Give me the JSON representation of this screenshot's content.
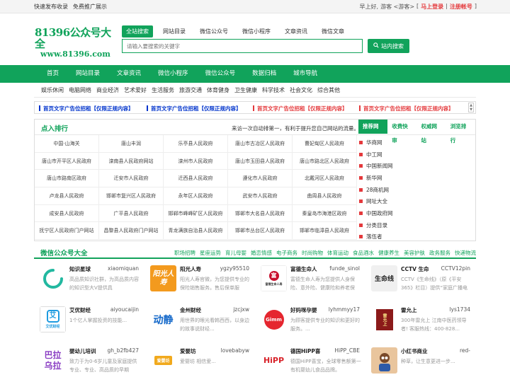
{
  "topbar": {
    "links": [
      "快速发布收录",
      "免费推广展示"
    ],
    "greeting": "早上好,",
    "guest": "游客 <游客>",
    "bracket_open": "[",
    "login": "马上登录",
    "sep": "|",
    "register": "注册帐号",
    "bracket_close": "]"
  },
  "logo": {
    "line1": "81396公众号大全",
    "line2": "www.81396.com"
  },
  "search": {
    "tabs": [
      "全站搜索",
      "网站目录",
      "微信公众号",
      "微信小程序",
      "文章资讯",
      "微信文章"
    ],
    "placeholder": "请输入要搜索的关键字",
    "button": "站内搜索",
    "button_icon": "search-icon"
  },
  "mainnav": [
    "首页",
    "网站目录",
    "文章资讯",
    "微信小程序",
    "微信公众号",
    "数据归档",
    "城市导航"
  ],
  "subnav": [
    "娱乐休闲",
    "电脑网络",
    "商业经济",
    "艺术爱好",
    "生活服务",
    "旅游交通",
    "体育健身",
    "卫生健康",
    "科学技术",
    "社会文化",
    "综合其他"
  ],
  "ads": [
    {
      "text": "首页文字广告位招租【仅限正规内容】",
      "color": "blue"
    },
    {
      "text": "首页文字广告位招租【仅限正规内容】",
      "color": "blue"
    },
    {
      "text": "首页文字广告位招租【仅限正规内容】",
      "color": "red"
    },
    {
      "text": "首页文字广告位招租【仅限正规内容】",
      "color": "red"
    }
  ],
  "ranking": {
    "title": "点入排行",
    "tip": "来访一次自动排第一，有利于提升您自己网站的流量。",
    "tabs": [
      "推荐网站",
      "收费快审",
      "权威网站",
      "浏览排行"
    ],
    "grid": [
      [
        "中国·山海关",
        "唐山丰润",
        "乐亭县人民政府",
        "唐山市古冶区人民政府",
        "曹妃甸区人民政府"
      ],
      [
        "唐山市开平区人民政府",
        "滦南县人民政府网站",
        "滦州市人民政府",
        "唐山市玉田县人民政府",
        "唐山市路北区人民政府"
      ],
      [
        "唐山市路南区政府",
        "迁安市人民政府",
        "迁西县人民政府",
        "遵化市人民政府",
        "北戴河区人民政府"
      ],
      [
        "卢龙县人民政府",
        "邯郸市复兴区人民政府",
        "永年区人民政府",
        "武安市人民政府",
        "曲周县人民政府"
      ],
      [
        "成安县人民政府",
        "广平县人民政府",
        "邯郸市峰峰矿区人民政府",
        "邯郸市大名县人民政府",
        "秦皇岛市海港区政府"
      ],
      [
        "抚宁区人民政府门户网站",
        "昌黎县人民政府门户网站",
        "青龙满族自治县人民政府",
        "邯郸市丛台区人民政府",
        "邯郸市临漳县人民政府"
      ]
    ],
    "list": [
      "华商网",
      "中工网",
      "中国新闻网",
      "新华网",
      "28商机网",
      "网址大全",
      "中国政府网",
      "分类目录",
      "落伍者"
    ]
  },
  "wechat": {
    "title": "微信公众号大全",
    "tags": [
      "职场招聘",
      "星座运势",
      "育儿母婴",
      "婚恋情感",
      "电子商务",
      "时尚购物",
      "体育运动",
      "食品酒水",
      "健康养生",
      "美容护肤",
      "政务服务",
      "快递物流"
    ],
    "cards": [
      {
        "name": "知识星球",
        "id": "xiaomiquan",
        "desc": "高品质知识社群，为高品质内容的知识型大V提供具",
        "icon": "ring-icon"
      },
      {
        "name": "阳光人寿",
        "id": "ygzy95510",
        "desc": "阳光人寿官微，为您提供专业的保险销售服务。售后保单服",
        "icon": "sunshine-logo-icon",
        "logo": "阳光人寿"
      },
      {
        "name": "富德生命人",
        "id": "funde_sinol",
        "desc": "富德生命人寿为您提供人身保险、意外险、健康险和养老保",
        "icon": "funde-logo-icon",
        "logo": "富德生命人寿"
      },
      {
        "name": "CCTV 生命",
        "id": "CCTV12pin",
        "desc": "CCTV《生命线》（原《平安365》栏目）提供“家庭广播电视",
        "icon": "lifeline-logo-icon",
        "logo": "生命线"
      },
      {
        "name": "艾优财经",
        "id": "aiyoucaijin",
        "desc": "1个亿人掌握投资的技能...",
        "icon": "aiyou-logo-icon",
        "logo": "艾",
        "sub": "艾优财经"
      },
      {
        "name": "金州财经",
        "id": "jzcjxw",
        "desc": "用世界的眼光看韩西西，以身边的故事说财经...",
        "icon": "dongjing-logo-icon",
        "logo": "动静"
      },
      {
        "name": "好妈咪孕婴",
        "id": "lyhmmyy17",
        "desc": "为顾客提供专业的知识和更好的服务。...",
        "icon": "gimm-logo-icon",
        "logo": "Gimm"
      },
      {
        "name": "雷允上",
        "id": "lys1734",
        "desc": "300年雷允上 江南中医药领导者! 客服热线：400-828...",
        "icon": "leiyunshang-logo-icon",
        "logo": "雷允上"
      },
      {
        "name": "婴幼儿培训",
        "id": "gh_b2fb427",
        "desc": "致力于为0-6岁儿童及家庭提供专业、专业、高品质的早期",
        "icon": "balala-logo-icon",
        "logo": "巴拉乌拉"
      },
      {
        "name": "爱婴坊",
        "id": "lovebabyw",
        "desc": "爱婴坊 相信爱...",
        "icon": "aiyingfang-logo-icon",
        "logo": "爱婴坊"
      },
      {
        "name": "德国HiPP喜",
        "id": "HiPP_CBE",
        "desc": "德国HiPP喜宝，全球零售额第一有机婴幼儿食品品牌。",
        "icon": "hipp-logo-icon",
        "logo": "HiPP"
      },
      {
        "name": "小红书商业",
        "id": "red-",
        "desc": "种草，让生意更进一步...",
        "icon": "avatar-icon"
      }
    ]
  }
}
